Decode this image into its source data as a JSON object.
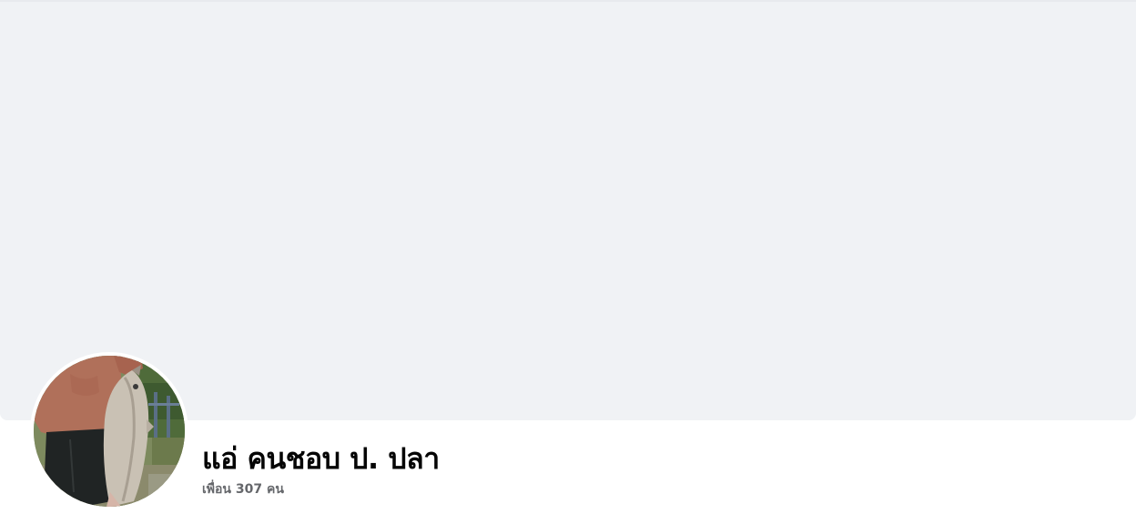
{
  "profile": {
    "name": "แอ่ คนชอบ ป. ปลา",
    "friends_text": "เพื่อน 307 คน"
  },
  "colors": {
    "cover_background": "#f0f2f5",
    "name_text": "#050505",
    "secondary_text": "#65676b"
  }
}
